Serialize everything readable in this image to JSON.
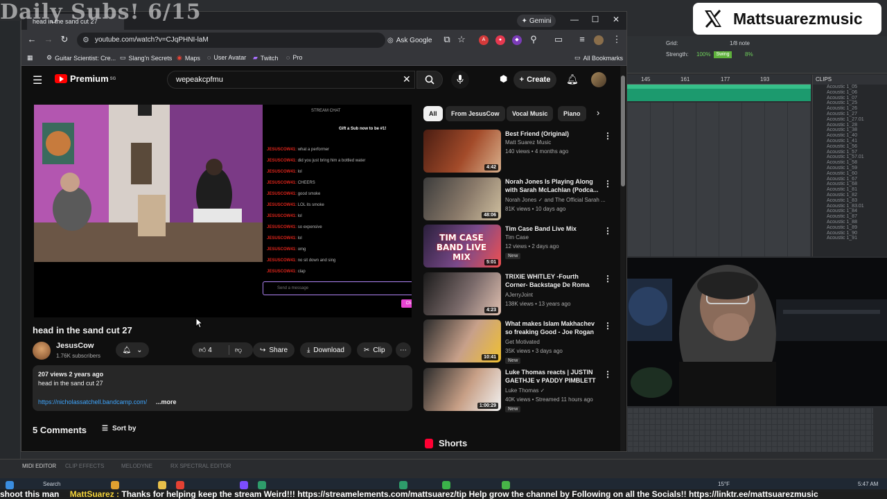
{
  "overlay": {
    "stream_title": "Daily Subs! 6/15",
    "x_handle": "Mattsuarezmusic",
    "ticker": {
      "prefix": "shoot  this man",
      "user": "MattSuarez :",
      "message": "Thanks for helping keep the stream Weird!!! https://streamelements.com/mattsuarez/tip  Help grow the channel by Following on all the Socials!! https://linktr.ee/mattsuarezmusic"
    }
  },
  "daw": {
    "grid_label": "Grid:",
    "grid_value": "1/8 note",
    "strength_label": "Strength:",
    "strength_value": "100%",
    "swing_label": "Swing",
    "swing_value": "8%",
    "ruler": [
      "145",
      "161",
      "177",
      "193"
    ],
    "clips_title": "CLIPS",
    "clips": [
      "Acoustic 1_05",
      "Acoustic 1_06",
      "Acoustic 1_07",
      "Acoustic 1_25",
      "Acoustic 1_26",
      "Acoustic 1_27",
      "Acoustic 1_27.01",
      "Acoustic 1_28",
      "Acoustic 1_38",
      "Acoustic 1_40",
      "Acoustic 1_41",
      "Acoustic 1_56",
      "Acoustic 1_57",
      "Acoustic 1_57.01",
      "Acoustic 1_58",
      "Acoustic 1_59",
      "Acoustic 1_60",
      "Acoustic 1_67",
      "Acoustic 1_68",
      "Acoustic 1_81",
      "Acoustic 1_82",
      "Acoustic 1_83",
      "Acoustic 1_83.01",
      "Acoustic 1_84",
      "Acoustic 1_87",
      "Acoustic 1_88",
      "Acoustic 1_89",
      "Acoustic 1_90",
      "Acoustic 1_91"
    ],
    "bottom_tabs": [
      "MIDI EDITOR",
      "CLIP EFFECTS",
      "MELODYNE",
      "RX SPECTRAL EDITOR"
    ]
  },
  "taskbar": {
    "search_label": "Search",
    "weather": "15°F",
    "time": "5:47 AM"
  },
  "browser": {
    "tab_title": "head in the sand cut 27",
    "gemini_label": "Gemini",
    "url": "youtube.com/watch?v=CJqPHNI-laM",
    "ask_google": "Ask Google",
    "bookmarks": [
      "Guitar Scientist: Cre...",
      "Slang'n Secrets",
      "Maps",
      "User Avatar",
      "Twitch",
      "Pro"
    ],
    "all_bookmarks": "All Bookmarks"
  },
  "youtube": {
    "logo_text": "Premium",
    "logo_sup": "SG",
    "search_value": "wepeakcpfmu",
    "create_label": "Create",
    "player_chat": {
      "header": "STREAM CHAT",
      "gift_text": "Gift a Sub now to be #1!",
      "lines": [
        {
          "user": "JESUSCOW41:",
          "text": "what a performer"
        },
        {
          "user": "JESUSCOW41:",
          "text": "did you just bring him a bottled water"
        },
        {
          "user": "JESUSCOW41:",
          "text": "lol"
        },
        {
          "user": "JESUSCOW41:",
          "text": "CHEERS"
        },
        {
          "user": "JESUSCOW41:",
          "text": "good smoke"
        },
        {
          "user": "JESUSCOW41:",
          "text": "LOL its smoke"
        },
        {
          "user": "JESUSCOW41:",
          "text": "lol"
        },
        {
          "user": "JESUSCOW41:",
          "text": "so expensive"
        },
        {
          "user": "JESUSCOW41:",
          "text": "lol"
        },
        {
          "user": "JESUSCOW41:",
          "text": "omg"
        },
        {
          "user": "JESUSCOW41:",
          "text": "no sit down and sing"
        },
        {
          "user": "JESUSCOW41:",
          "text": "clap"
        }
      ],
      "input_placeholder": "Send a message",
      "send_label": "Chat"
    },
    "video_title": "head in the sand cut 27",
    "channel_name": "JesusCow",
    "channel_subs": "1.76K subscribers",
    "likes": "4",
    "share_label": "Share",
    "download_label": "Download",
    "clip_label": "Clip",
    "description": {
      "meta": "207 views  2 years ago",
      "text": "head in the sand cut 27",
      "link": "https://nicholassatchell.bandcamp.com/",
      "more": "...more"
    },
    "comments_label": "5 Comments",
    "sort_label": "Sort by",
    "chips": [
      "All",
      "From JesusCow",
      "Vocal Music",
      "Piano"
    ],
    "recommendations": [
      {
        "title": "Best Friend (Original)",
        "channel": "Matt Suarez Music",
        "meta": "140 views • 4 months ago",
        "duration": "4:42",
        "new": ""
      },
      {
        "title": "Norah Jones Is Playing Along with Sarah McLachlan (Podca...",
        "channel": "Norah Jones ✓ and The Official Sarah ...",
        "meta": "81K views • 10 days ago",
        "duration": "48:06",
        "new": ""
      },
      {
        "title": "Tim Case Band Live Mix",
        "channel": "Tim Case",
        "meta": "12 views • 2 days ago",
        "duration": "5:01",
        "new": "New"
      },
      {
        "title": "TRIXIE WHITLEY -Fourth Corner- Backstage De Roma",
        "channel": "AJerryJoint",
        "meta": "138K views • 13 years ago",
        "duration": "4:23",
        "new": ""
      },
      {
        "title": "What makes Islam Makhachev so freaking Good - Joe Rogan",
        "channel": "Get Motivated",
        "meta": "35K views • 3 days ago",
        "duration": "10:41",
        "new": "New"
      },
      {
        "title": "Luke Thomas reacts | JUSTIN GAETHJE v PADDY PIMBLETT ...",
        "channel": "Luke Thomas ✓",
        "meta": "40K views • Streamed 11 hours ago",
        "duration": "1:00:29",
        "new": "New"
      }
    ],
    "thumb_overlay": "TIM CASE BAND LIVE MIX",
    "shorts_label": "Shorts"
  }
}
